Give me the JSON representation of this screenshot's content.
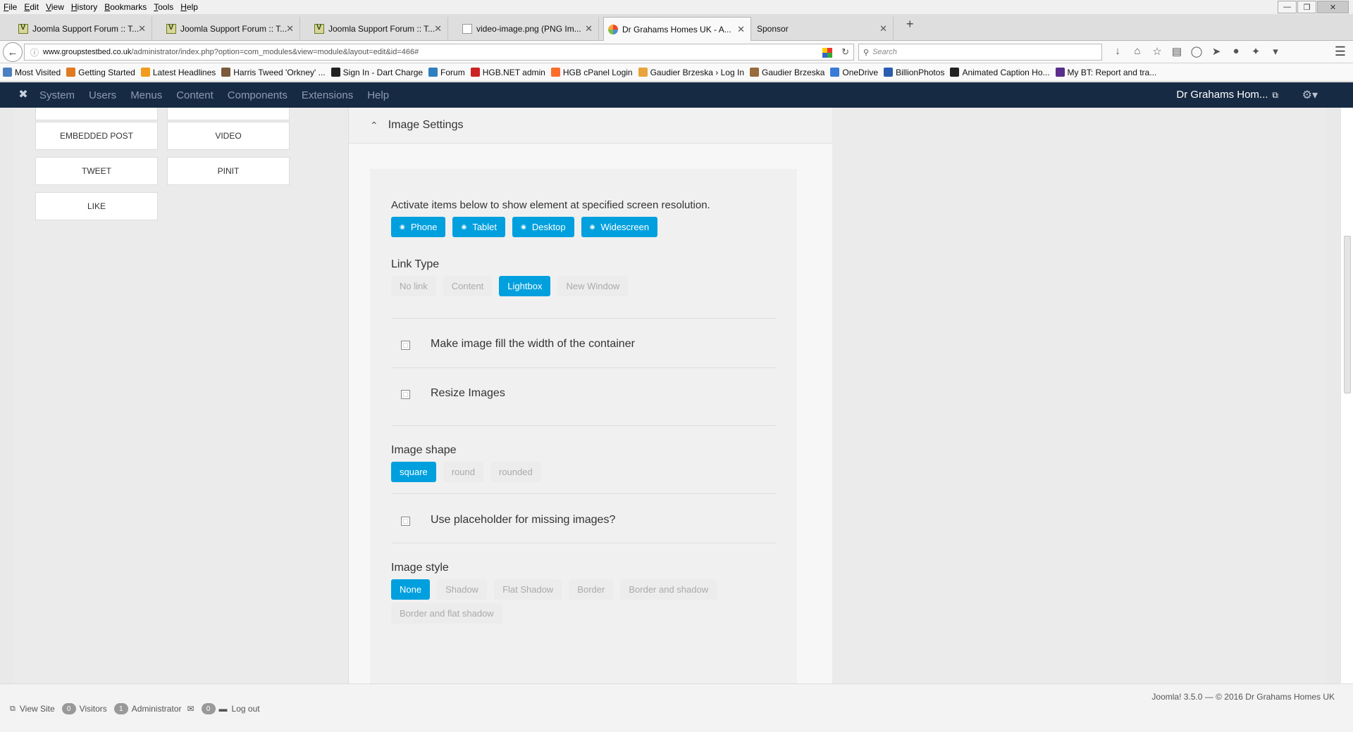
{
  "browser": {
    "menu": [
      "File",
      "Edit",
      "View",
      "History",
      "Bookmarks",
      "Tools",
      "Help"
    ],
    "tabs": [
      {
        "title": "Joomla Support Forum :: T...",
        "icon": "forum"
      },
      {
        "title": "Joomla Support Forum :: T...",
        "icon": "forum"
      },
      {
        "title": "Joomla Support Forum :: T...",
        "icon": "forum"
      },
      {
        "title": "video-image.png (PNG Im...",
        "icon": "png"
      },
      {
        "title": "Dr Grahams Homes UK - A...",
        "icon": "joomla",
        "active": true
      },
      {
        "title": "Sponsor",
        "icon": "none"
      }
    ],
    "url_host": "www.groupstestbed.co.uk",
    "url_path": "/administrator/index.php?option=com_modules&view=module&layout=edit&id=466#",
    "search_placeholder": "Search",
    "bookmarks": [
      {
        "label": "Most Visited",
        "color": "#4a7fc0"
      },
      {
        "label": "Getting Started",
        "color": "#e07a20"
      },
      {
        "label": "Latest Headlines",
        "color": "#f29c1f"
      },
      {
        "label": "Harris Tweed 'Orkney' ...",
        "color": "#7b5a3c"
      },
      {
        "label": "Sign In - Dart Charge",
        "color": "#222222"
      },
      {
        "label": "Forum",
        "color": "#2f7ebd"
      },
      {
        "label": "HGB.NET admin",
        "color": "#cc2222"
      },
      {
        "label": "HGB cPanel Login",
        "color": "#ff6c2c"
      },
      {
        "label": "Gaudier Brzeska › Log In",
        "color": "#e8a33b"
      },
      {
        "label": "Gaudier Brzeska",
        "color": "#9a6b3c"
      },
      {
        "label": "OneDrive",
        "color": "#3a7bd5"
      },
      {
        "label": "BillionPhotos",
        "color": "#2a5db0"
      },
      {
        "label": "Animated Caption Ho...",
        "color": "#222222"
      },
      {
        "label": "My BT: Report and tra...",
        "color": "#5a2d8a"
      }
    ]
  },
  "joomla": {
    "menu": [
      "System",
      "Users",
      "Menus",
      "Content",
      "Components",
      "Extensions",
      "Help"
    ],
    "site_title": "Dr Grahams Hom...",
    "left_buttons": [
      "EMBEDDED POST",
      "VIDEO",
      "TWEET",
      "PINIT",
      "LIKE"
    ],
    "section_title": "Image Settings",
    "activate_text": "Activate items below to show element at specified screen resolution.",
    "devices": [
      "Phone",
      "Tablet",
      "Desktop",
      "Widescreen"
    ],
    "link_type": {
      "label": "Link Type",
      "options": [
        "No link",
        "Content",
        "Lightbox",
        "New Window"
      ],
      "selected": "Lightbox"
    },
    "fill_width_label": "Make image fill the width of the container",
    "resize_label": "Resize Images",
    "image_shape": {
      "label": "Image shape",
      "options": [
        "square",
        "round",
        "rounded"
      ],
      "selected": "square"
    },
    "placeholder_label": "Use placeholder for missing images?",
    "image_style": {
      "label": "Image style",
      "options": [
        "None",
        "Shadow",
        "Flat Shadow",
        "Border",
        "Border and shadow",
        "Border and flat shadow"
      ],
      "selected": "None"
    },
    "footer": {
      "view_site": "View Site",
      "visitors_count": "0",
      "visitors_label": "Visitors",
      "admin_count": "1",
      "admin_label": "Administrator",
      "messages_count": "0",
      "logout": "Log out",
      "copyright": "Joomla! 3.5.0  —  © 2016 Dr Grahams Homes UK"
    }
  },
  "colors": {
    "accent": "#00a0de",
    "adminbar": "#172a44"
  }
}
